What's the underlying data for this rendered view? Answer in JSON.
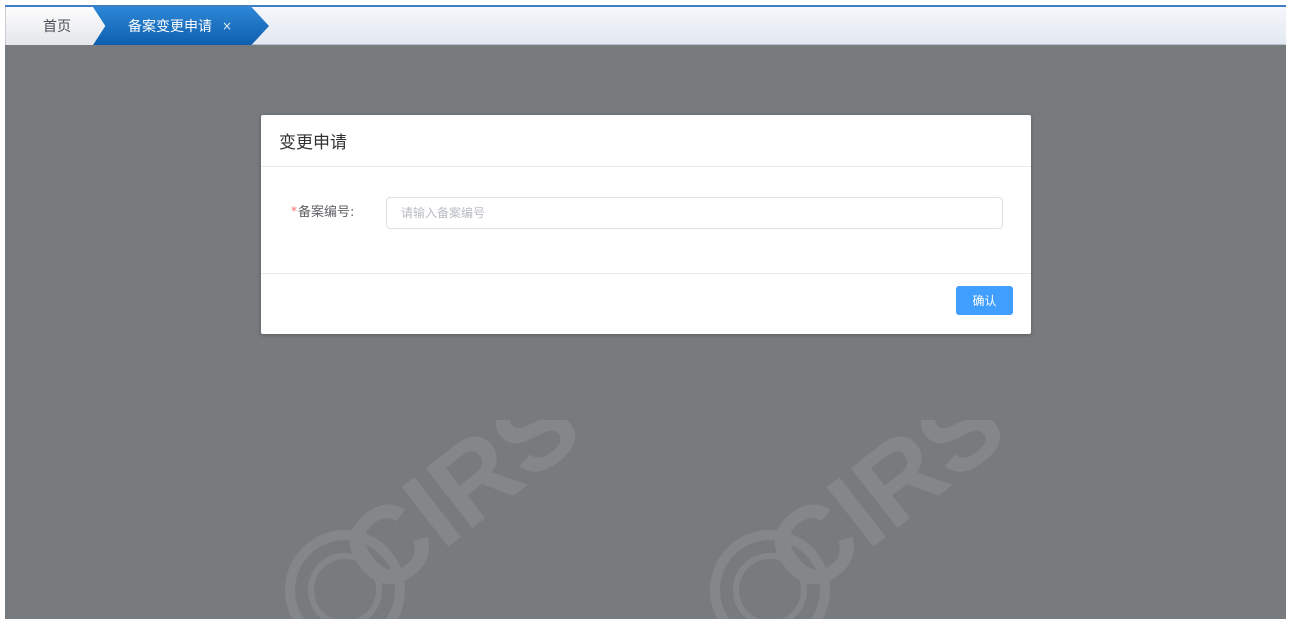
{
  "tabs": {
    "home_label": "首页",
    "active_label": "备案变更申请",
    "close_glyph": "×"
  },
  "dialog": {
    "title": "变更申请",
    "form": {
      "required_mark": "*",
      "label": "备案编号:",
      "value": "",
      "placeholder": "请输入备案编号"
    },
    "confirm_label": "确认"
  },
  "watermark": {
    "text": "CIRS"
  },
  "colors": {
    "tab_active": "#1a6fc2",
    "overlay": "#787b7e",
    "primary_button": "#409eff",
    "required": "#f56c6c"
  }
}
